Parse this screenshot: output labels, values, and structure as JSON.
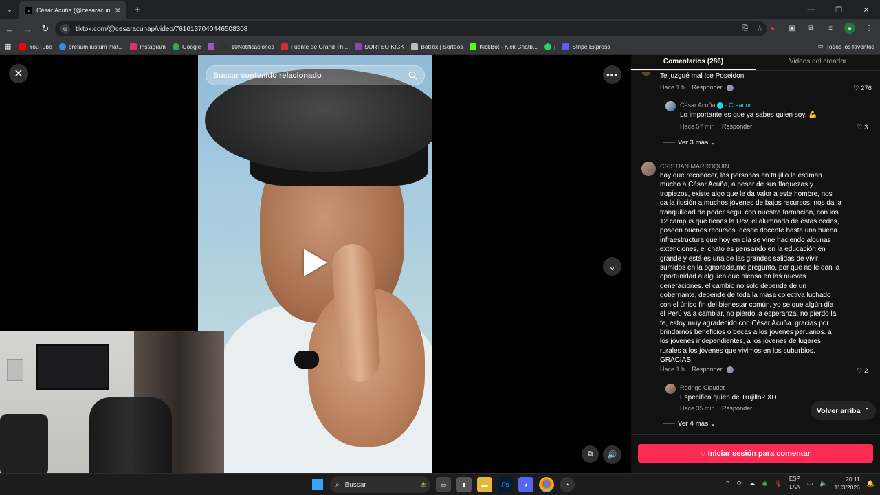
{
  "browser": {
    "tab_title": "César Acuña (@cesaracunap) | T",
    "url": "tiktok.com/@cesaracunap/video/7616137040446508308",
    "bookmarks": [
      {
        "label": "YouTube",
        "color": "#ff0000"
      },
      {
        "label": "pretium iustum mat...",
        "color": "#4285f4"
      },
      {
        "label": "Instagram",
        "color": "#e1306c"
      },
      {
        "label": "Google",
        "color": "#34a853"
      },
      {
        "label": "",
        "color": "#9b59b6"
      },
      {
        "label": "10Notificaciones",
        "color": "#333333"
      },
      {
        "label": "Fuente de Grand Th...",
        "color": "#d32f2f"
      },
      {
        "label": "SORTEO KICK",
        "color": "#8e44ad"
      },
      {
        "label": "BotRix | Sorteos",
        "color": "#bbbbbb"
      },
      {
        "label": "KickBot - Kick Chatb...",
        "color": "#53fc18"
      },
      {
        "label": "|",
        "color": "#25d366"
      },
      {
        "label": "Stripe Express",
        "color": "#635bff"
      }
    ],
    "all_bookmarks": "Todos los favoritos"
  },
  "video": {
    "search_placeholder": "Buscar contenido relacionado"
  },
  "panel": {
    "tab_comments": "Comentarios (286)",
    "tab_videos": "Videos del creador",
    "comments": [
      {
        "text": "Te juzgué mal Ice Poseidon",
        "time": "Hace 1 h",
        "reply": "Responder",
        "likes": "276"
      },
      {
        "author": "César Acuña",
        "creator": "· Creador",
        "text": "Lo importante es que ya sabes quien soy. 💪",
        "time": "Hace 57 min",
        "reply": "Responder",
        "likes": "3"
      },
      {
        "author": "CRISTIAN MARROQUIN",
        "text_lines": [
          "hay que reconocer, las personas en trujillo le estiman",
          "mucho a César Acuña, a pesar de sus flaquezas y",
          "tropiezos, existe algo que le da valor a este hombre, nos",
          "da la ilusión a muchos jóvenes de bajos recursos, nos da la",
          "tranquilidad de poder segui con nuestra formacion, con los",
          "12 campus que tienes la Ucv, el alumnado de estas cedes,",
          "poseen buenos recursos. desde docente hasta una buena",
          "infraestructura que hoy en día se vine haciendo algunas",
          "extenciones, el chato es pensando en la educación en",
          "grande y está es una de las grandes salidas de vivir",
          "sumidos en la ognoracia,me pregunto, por que no le dan la",
          "oportunidad a alguien que piensa en las nuevas",
          "generaciones. el cambio no solo depende de un",
          "gobernante, depende de toda la masa colectiva luchado",
          "con el único fin del bienestar común, yo se que algún día",
          "el Perú va a cambiar, no pierdo la esperanza, no pierdo la",
          "fe, estoy muy agradecido con César Acuña. gracias por",
          "brindarnos beneficios o becas a los jóvenes peruanos. a",
          "los jóvenes independientes, a los jóvenes de lugares",
          "rurales a los jóvenes que vivimos en los suburbios.",
          "GRACIAS."
        ],
        "time": "Hace 1 h",
        "reply": "Responder",
        "likes": "2"
      },
      {
        "author": "Rodrigo Claudet",
        "text": "Especifica quién de Trujillo? XD",
        "time": "Hace 35 min",
        "reply": "Responder"
      }
    ],
    "see_more_1": "Ver 3 más",
    "see_more_2": "Ver 4 más",
    "back_to_top": "Volver arriba",
    "login_button": "Iniciar sesión para comentar"
  },
  "taskbar": {
    "search": "Buscar",
    "lang_1": "ESP",
    "lang_2": "LAA",
    "time": "20:11",
    "date": "11/3/2026"
  },
  "colors": {
    "accent": "#fe2c55",
    "creator": "#20d5ec"
  }
}
